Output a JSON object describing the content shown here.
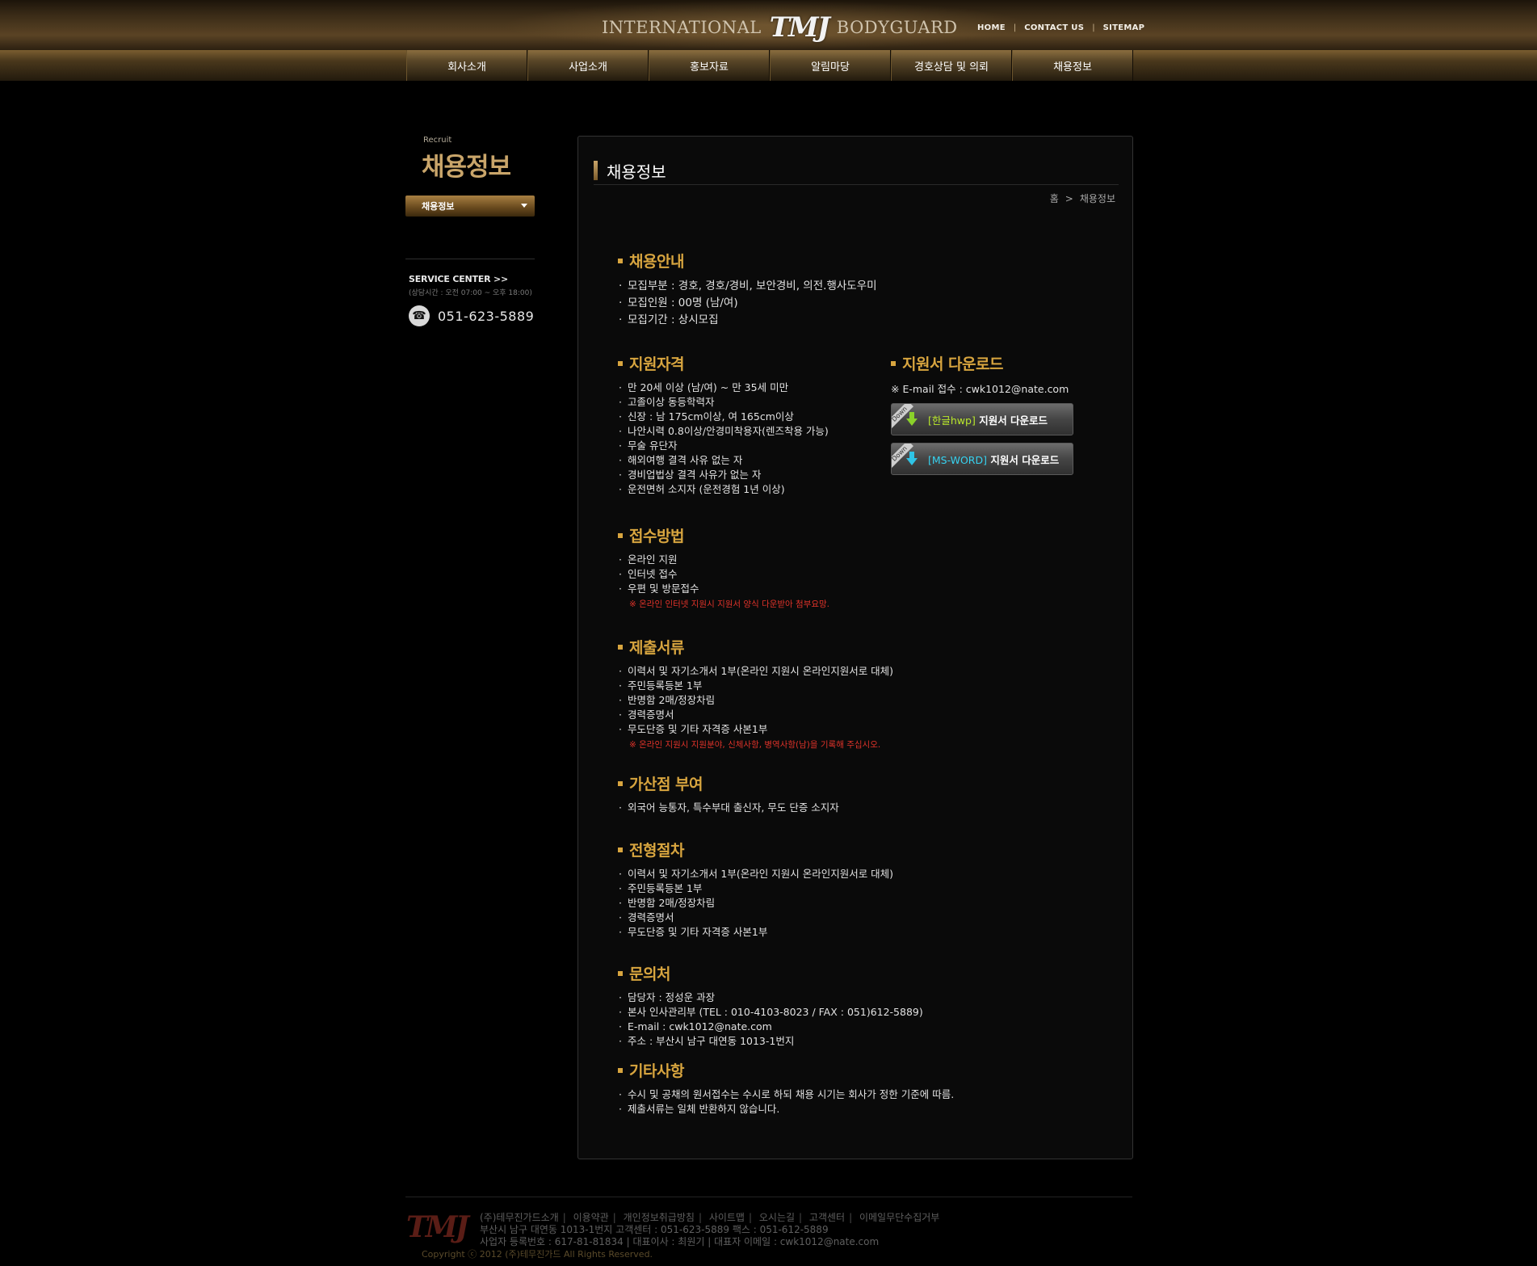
{
  "header": {
    "logo_left": "INTERNATIONAL",
    "logo_mark": "TMJ",
    "logo_right": "BODYGUARD",
    "util": [
      "HOME",
      "CONTACT US",
      "SITEMAP"
    ]
  },
  "gnb": [
    "회사소개",
    "사업소개",
    "홍보자료",
    "알림마당",
    "경호상담 및 의뢰",
    "채용정보"
  ],
  "side": {
    "sub": "Recruit",
    "title": "채용정보",
    "menu": "채용정보",
    "service_title": "SERVICE CENTER >>",
    "service_hours": "(상담시간 : 오전 07:00 ~ 오후 18:00)",
    "phone": "051-623-5889"
  },
  "content": {
    "title": "채용정보",
    "breadcrumb": [
      "홈",
      ">",
      "채용정보"
    ],
    "guide": {
      "title": "채용안내",
      "items": [
        "모집부분 : 경호, 경호/경비, 보안경비, 의전.행사도우미",
        "모집인원 : 00명 (남/여)",
        "모집기간 : 상시모집"
      ]
    },
    "qualification": {
      "title": "지원자격",
      "items": [
        "만 20세 이상 (남/여) ~ 만 35세 미만",
        "고졸이상 동등학력자",
        "신장 : 남 175cm이상, 여 165cm이상",
        "나안시력 0.8이상/안경미착용자(렌즈착용 가능)",
        "무술 유단자",
        "해외여행 결격 사유 없는 자",
        "경비업법상 결격 사유가 없는 자",
        "운전면허 소지자 (운전경험 1년 이상)"
      ]
    },
    "download": {
      "title": "지원서 다운로드",
      "email": "※ E-mail 접수 : cwk1012@nate.com",
      "ribbon": "Down",
      "hwp_tag": "[한글hwp]",
      "word_tag": "[MS-WORD]",
      "btn_label": "지원서 다운로드",
      "colors": {
        "hwp": "#8bd12a",
        "word": "#2fc4e6"
      }
    },
    "method": {
      "title": "접수방법",
      "items": [
        "온라인 지원",
        "인터넷 접수",
        "우편 및 방문접수"
      ],
      "note": "※ 온라인 인터넷 지원시 지원서 양식 다운받아 첨부요망."
    },
    "documents": {
      "title": "제출서류",
      "items": [
        "이력서 및 자기소개서 1부(온라인 지원시 온라인지원서로 대체)",
        "주민등록등본 1부",
        "반명함 2매/정장차림",
        "경력증명서",
        "무도단증 및 기타 자격증 사본1부"
      ],
      "note": "※ 온라인 지원시 지원분야, 신체사항, 병역사항(남)을 기록해 주십시오."
    },
    "bonus": {
      "title": "가산점 부여",
      "items": [
        "외국어 능통자, 특수부대 출신자, 무도 단증 소지자"
      ]
    },
    "process": {
      "title": "전형절차",
      "items": [
        "이력서 및 자기소개서 1부(온라인 지원시 온라인지원서로 대체)",
        "주민등록등본 1부",
        "반명함 2매/정장차림",
        "경력증명서",
        "무도단증 및 기타 자격증 사본1부"
      ]
    },
    "contact": {
      "title": "문의처",
      "items": [
        "담당자 : 정성운 과장",
        "본사 인사관리부 (TEL : 010-4103-8023  / FAX : 051)612-5889)",
        "E-mail : cwk1012@nate.com",
        "주소 : 부산시 남구 대연동 1013-1번지"
      ]
    },
    "etc": {
      "title": "기타사항",
      "items": [
        "수시 및 공채의 원서접수는 수시로 하되 채용 시기는 회사가 정한 기준에 따름.",
        "제출서류는 일체 반환하지 않습니다."
      ]
    }
  },
  "footer": {
    "logo": "TMJ",
    "links": [
      "(주)테무진가드소개",
      "이용약관",
      "개인정보취급방침",
      "사이트맵",
      "오시는길",
      "고객센터",
      "이메일무단수집거부"
    ],
    "address": "부산시 남구 대연동 1013-1번지 고객센터 : 051-623-5889 팩스 : 051-612-5889",
    "biz": "사업자 등록번호 : 617-81-81834 | 대표이사 : 최원기 | 대표자 이메일 : cwk1012@nate.com",
    "copyright": "Copyright ⓒ 2012 (주)테무진가드 All Rights Reserved."
  }
}
